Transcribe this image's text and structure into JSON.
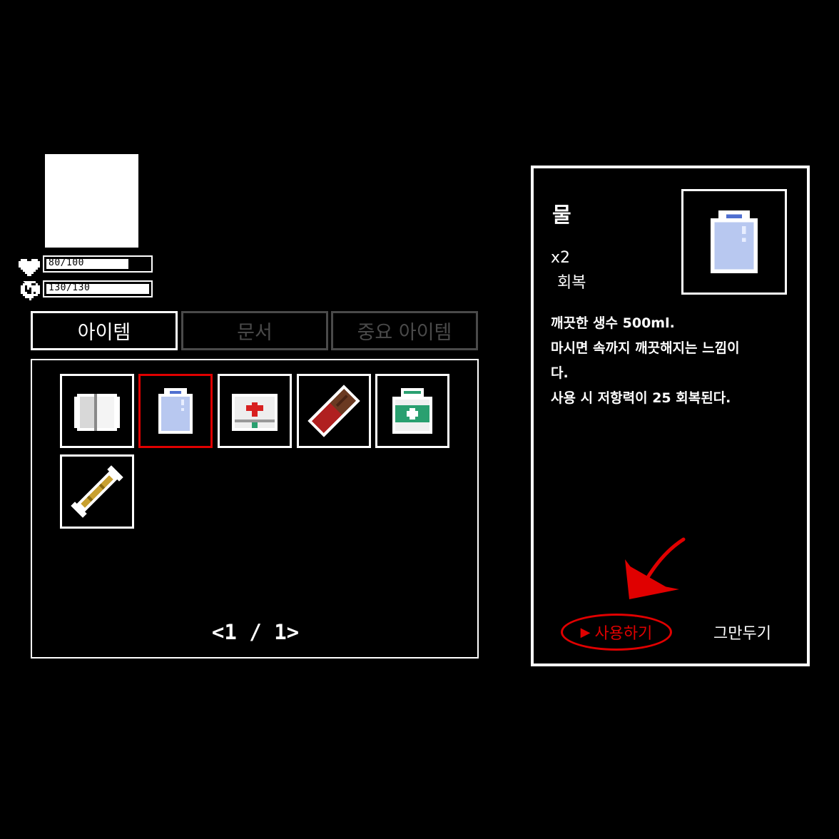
{
  "player": {
    "hp": {
      "text": "80/100",
      "value": 80,
      "max": 100,
      "icon": "heart-icon"
    },
    "mind": {
      "text": "130/130",
      "value": 130,
      "max": 130,
      "icon": "brain-icon"
    }
  },
  "tabs": [
    {
      "label": "아이템",
      "active": true
    },
    {
      "label": "문서",
      "active": false
    },
    {
      "label": "중요 아이템",
      "active": false
    }
  ],
  "inventory": {
    "slots": [
      {
        "icon": "toilet-paper-icon",
        "selected": false
      },
      {
        "icon": "water-bottle-icon",
        "selected": true
      },
      {
        "icon": "first-aid-kit-icon",
        "selected": false
      },
      {
        "icon": "chocolate-bar-icon",
        "selected": false
      },
      {
        "icon": "medicine-bottle-icon",
        "selected": false
      },
      {
        "icon": "bandage-roll-icon",
        "selected": false
      }
    ],
    "pager": "<1 / 1>"
  },
  "detail": {
    "name": "물",
    "count": "x2",
    "type": "회복",
    "description": [
      "깨끗한 생수 500ml.",
      "마시면 속까지 깨끗해지는 느낌이",
      "다.",
      "사용 시 저항력이 25 회복된다."
    ],
    "use_label": "사용하기",
    "cancel_label": "그만두기"
  },
  "colors": {
    "accent": "#e00000",
    "inactive": "#4a4a4a",
    "water": "#b8c8f0"
  }
}
